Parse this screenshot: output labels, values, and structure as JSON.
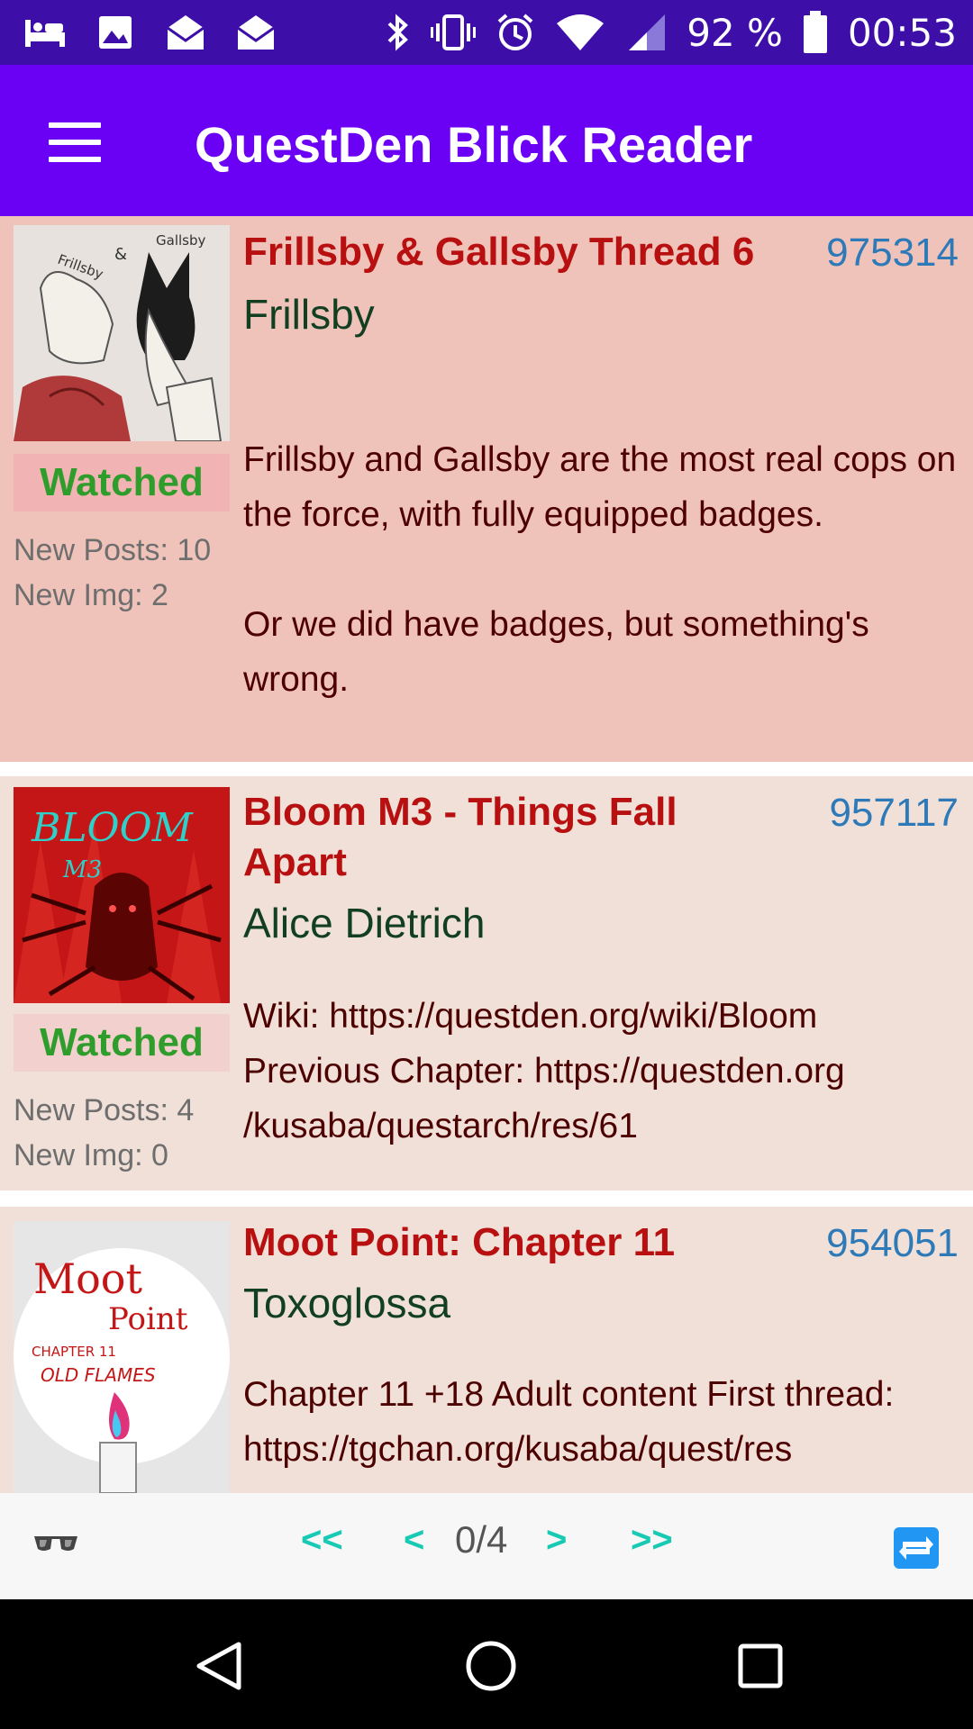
{
  "status_bar": {
    "left_icons": [
      "hotel-icon",
      "image-icon",
      "mail-open-icon",
      "mail-open-icon"
    ],
    "battery": "92 %",
    "time": "00:53"
  },
  "app_bar": {
    "title": "QuestDen Blick Reader",
    "color": "#6a00f4"
  },
  "threads": [
    {
      "title": "Frillsby & Gallsby Thread 6",
      "id": "975314",
      "author": "Frillsby",
      "watched_label": "Watched",
      "new_posts": "New Posts: 10",
      "new_img": "New Img: 2",
      "description": "Frillsby and Gallsby are the most real cops on the force, with fully equipped badges.\n\nOr we did have badges, but something's wrong."
    },
    {
      "title": "Bloom M3 - Things Fall Apart",
      "id": "957117",
      "author": "Alice Dietrich",
      "watched_label": "Watched",
      "new_posts": "New Posts: 4",
      "new_img": "New Img: 0",
      "description": "Wiki: https://questden.org/wiki/Bloom\nPrevious Chapter: https://questden.org\n/kusaba/questarch/res/61"
    },
    {
      "title": "Moot Point: Chapter 11",
      "id": "954051",
      "author": "Toxoglossa",
      "description": "Chapter 11 +18 Adult content First thread:\nhttps://tgchan.org/kusaba/quest/res"
    }
  ],
  "thumb_text": {
    "frillsby_a": "Frillsby",
    "frillsby_amp": "&",
    "frillsby_b": "Gallsby",
    "bloom_a": "BLOOM",
    "bloom_b": "M3",
    "moot_a": "Moot",
    "moot_b": "Point",
    "moot_c": "CHAPTER 11",
    "moot_d": "OLD FLAMES"
  },
  "pager": {
    "first": "<<",
    "prev": "<",
    "page": "0/4",
    "next": ">",
    "last": ">>"
  },
  "colors": {
    "watched_bg": "#efc3b9",
    "normal_bg": "#f0e0d8",
    "title": "#b81010",
    "id": "#2e7ab8",
    "author": "#123f22",
    "watched_text": "#2f9d2c",
    "pager": "#18c9b4"
  }
}
